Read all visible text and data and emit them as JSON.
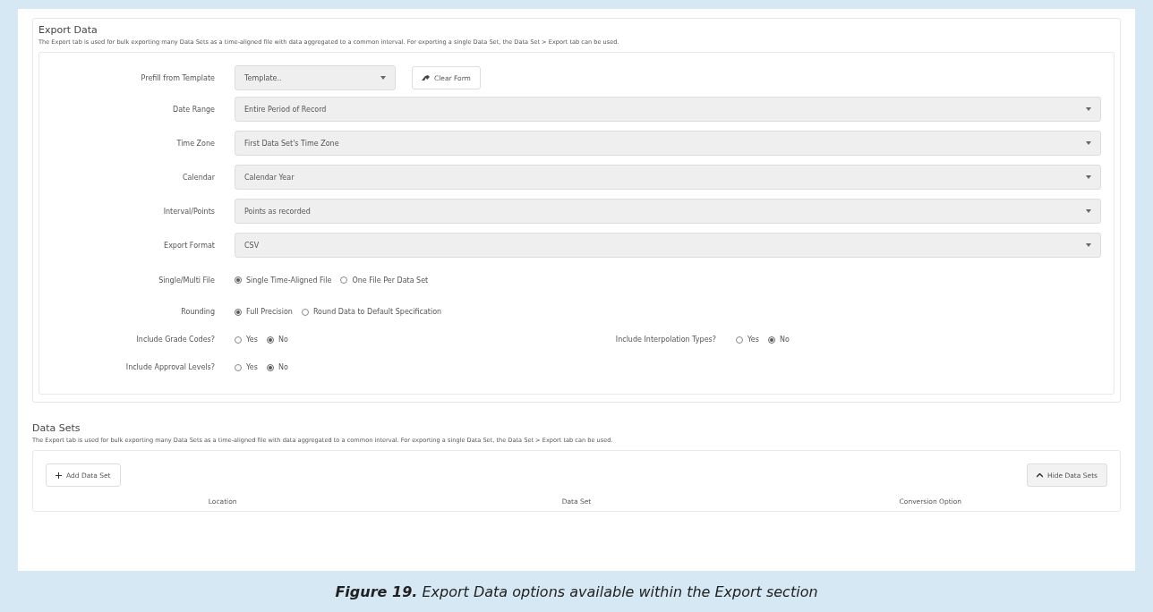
{
  "export_data": {
    "title": "Export Data",
    "description": "The Export tab is used for bulk exporting many Data Sets as a time-aligned file with data aggregated to a common interval. For exporting a single Data Set, the Data Set > Export tab can be used.",
    "template": {
      "label": "Prefill from Template",
      "value": "Template..",
      "clear_button": "Clear Form"
    },
    "selects": [
      {
        "label": "Date Range",
        "value": "Entire Period of Record"
      },
      {
        "label": "Time Zone",
        "value": "First Data Set's Time Zone"
      },
      {
        "label": "Calendar",
        "value": "Calendar Year"
      },
      {
        "label": "Interval/Points",
        "value": "Points as recorded"
      },
      {
        "label": "Export Format",
        "value": "CSV"
      }
    ],
    "radio_rows": [
      {
        "groups": [
          {
            "label": "Single/Multi File",
            "options": [
              {
                "label": "Single Time-Aligned File",
                "selected": true
              },
              {
                "label": "One File Per Data Set",
                "selected": false
              }
            ]
          }
        ]
      },
      {
        "groups": [
          {
            "label": "Rounding",
            "options": [
              {
                "label": "Full Precision",
                "selected": true
              },
              {
                "label": "Round Data to Default Specification",
                "selected": false
              }
            ]
          }
        ]
      },
      {
        "groups": [
          {
            "label": "Include Grade Codes?",
            "options": [
              {
                "label": "Yes",
                "selected": false
              },
              {
                "label": "No",
                "selected": true
              }
            ]
          },
          {
            "label": "Include Interpolation Types?",
            "options": [
              {
                "label": "Yes",
                "selected": false
              },
              {
                "label": "No",
                "selected": true
              }
            ]
          }
        ]
      },
      {
        "groups": [
          {
            "label": "Include Approval Levels?",
            "options": [
              {
                "label": "Yes",
                "selected": false
              },
              {
                "label": "No",
                "selected": true
              }
            ]
          }
        ]
      }
    ]
  },
  "data_sets": {
    "title": "Data Sets",
    "description": "The Export tab is used for bulk exporting many Data Sets as a time-aligned file with data aggregated to a common interval. For exporting a single Data Set, the Data Set > Export tab can be used.",
    "add_button": "Add Data Set",
    "hide_button": "Hide Data Sets",
    "columns": [
      "Location",
      "Data Set",
      "Conversion Option"
    ]
  },
  "caption": "**Figure 19.** Export Data options available within the Export section"
}
